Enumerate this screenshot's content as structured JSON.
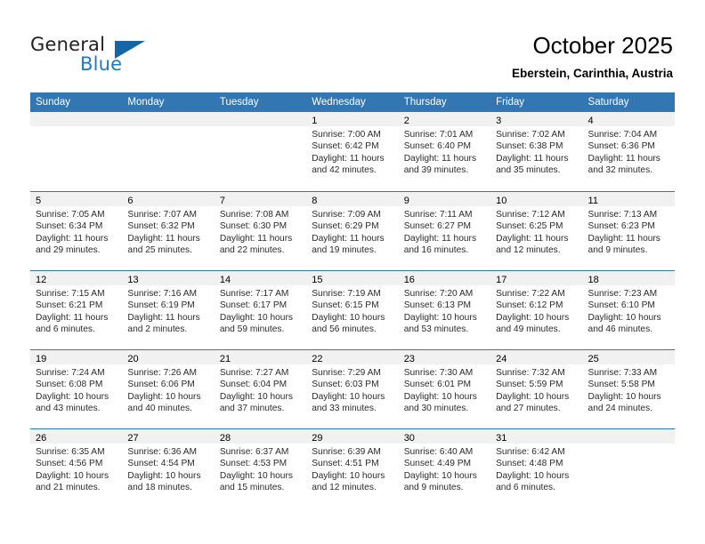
{
  "brand": {
    "name_part1": "General",
    "name_part2": "Blue",
    "logo_icon": "blue-triangle-flag-icon"
  },
  "header": {
    "month_title": "October 2025",
    "location": "Eberstein, Carinthia, Austria"
  },
  "colors": {
    "header_blue": "#3277b3",
    "brand_blue": "#1f7ac4",
    "band_gray": "#f1f1f1"
  },
  "calendar": {
    "weekdays": [
      "Sunday",
      "Monday",
      "Tuesday",
      "Wednesday",
      "Thursday",
      "Friday",
      "Saturday"
    ],
    "weeks": [
      [
        {
          "day": "",
          "sunrise": "",
          "sunset": "",
          "daylight": "",
          "daylight2": ""
        },
        {
          "day": "",
          "sunrise": "",
          "sunset": "",
          "daylight": "",
          "daylight2": ""
        },
        {
          "day": "",
          "sunrise": "",
          "sunset": "",
          "daylight": "",
          "daylight2": ""
        },
        {
          "day": "1",
          "sunrise": "Sunrise: 7:00 AM",
          "sunset": "Sunset: 6:42 PM",
          "daylight": "Daylight: 11 hours",
          "daylight2": "and 42 minutes."
        },
        {
          "day": "2",
          "sunrise": "Sunrise: 7:01 AM",
          "sunset": "Sunset: 6:40 PM",
          "daylight": "Daylight: 11 hours",
          "daylight2": "and 39 minutes."
        },
        {
          "day": "3",
          "sunrise": "Sunrise: 7:02 AM",
          "sunset": "Sunset: 6:38 PM",
          "daylight": "Daylight: 11 hours",
          "daylight2": "and 35 minutes."
        },
        {
          "day": "4",
          "sunrise": "Sunrise: 7:04 AM",
          "sunset": "Sunset: 6:36 PM",
          "daylight": "Daylight: 11 hours",
          "daylight2": "and 32 minutes."
        }
      ],
      [
        {
          "day": "5",
          "sunrise": "Sunrise: 7:05 AM",
          "sunset": "Sunset: 6:34 PM",
          "daylight": "Daylight: 11 hours",
          "daylight2": "and 29 minutes."
        },
        {
          "day": "6",
          "sunrise": "Sunrise: 7:07 AM",
          "sunset": "Sunset: 6:32 PM",
          "daylight": "Daylight: 11 hours",
          "daylight2": "and 25 minutes."
        },
        {
          "day": "7",
          "sunrise": "Sunrise: 7:08 AM",
          "sunset": "Sunset: 6:30 PM",
          "daylight": "Daylight: 11 hours",
          "daylight2": "and 22 minutes."
        },
        {
          "day": "8",
          "sunrise": "Sunrise: 7:09 AM",
          "sunset": "Sunset: 6:29 PM",
          "daylight": "Daylight: 11 hours",
          "daylight2": "and 19 minutes."
        },
        {
          "day": "9",
          "sunrise": "Sunrise: 7:11 AM",
          "sunset": "Sunset: 6:27 PM",
          "daylight": "Daylight: 11 hours",
          "daylight2": "and 16 minutes."
        },
        {
          "day": "10",
          "sunrise": "Sunrise: 7:12 AM",
          "sunset": "Sunset: 6:25 PM",
          "daylight": "Daylight: 11 hours",
          "daylight2": "and 12 minutes."
        },
        {
          "day": "11",
          "sunrise": "Sunrise: 7:13 AM",
          "sunset": "Sunset: 6:23 PM",
          "daylight": "Daylight: 11 hours",
          "daylight2": "and 9 minutes."
        }
      ],
      [
        {
          "day": "12",
          "sunrise": "Sunrise: 7:15 AM",
          "sunset": "Sunset: 6:21 PM",
          "daylight": "Daylight: 11 hours",
          "daylight2": "and 6 minutes."
        },
        {
          "day": "13",
          "sunrise": "Sunrise: 7:16 AM",
          "sunset": "Sunset: 6:19 PM",
          "daylight": "Daylight: 11 hours",
          "daylight2": "and 2 minutes."
        },
        {
          "day": "14",
          "sunrise": "Sunrise: 7:17 AM",
          "sunset": "Sunset: 6:17 PM",
          "daylight": "Daylight: 10 hours",
          "daylight2": "and 59 minutes."
        },
        {
          "day": "15",
          "sunrise": "Sunrise: 7:19 AM",
          "sunset": "Sunset: 6:15 PM",
          "daylight": "Daylight: 10 hours",
          "daylight2": "and 56 minutes."
        },
        {
          "day": "16",
          "sunrise": "Sunrise: 7:20 AM",
          "sunset": "Sunset: 6:13 PM",
          "daylight": "Daylight: 10 hours",
          "daylight2": "and 53 minutes."
        },
        {
          "day": "17",
          "sunrise": "Sunrise: 7:22 AM",
          "sunset": "Sunset: 6:12 PM",
          "daylight": "Daylight: 10 hours",
          "daylight2": "and 49 minutes."
        },
        {
          "day": "18",
          "sunrise": "Sunrise: 7:23 AM",
          "sunset": "Sunset: 6:10 PM",
          "daylight": "Daylight: 10 hours",
          "daylight2": "and 46 minutes."
        }
      ],
      [
        {
          "day": "19",
          "sunrise": "Sunrise: 7:24 AM",
          "sunset": "Sunset: 6:08 PM",
          "daylight": "Daylight: 10 hours",
          "daylight2": "and 43 minutes."
        },
        {
          "day": "20",
          "sunrise": "Sunrise: 7:26 AM",
          "sunset": "Sunset: 6:06 PM",
          "daylight": "Daylight: 10 hours",
          "daylight2": "and 40 minutes."
        },
        {
          "day": "21",
          "sunrise": "Sunrise: 7:27 AM",
          "sunset": "Sunset: 6:04 PM",
          "daylight": "Daylight: 10 hours",
          "daylight2": "and 37 minutes."
        },
        {
          "day": "22",
          "sunrise": "Sunrise: 7:29 AM",
          "sunset": "Sunset: 6:03 PM",
          "daylight": "Daylight: 10 hours",
          "daylight2": "and 33 minutes."
        },
        {
          "day": "23",
          "sunrise": "Sunrise: 7:30 AM",
          "sunset": "Sunset: 6:01 PM",
          "daylight": "Daylight: 10 hours",
          "daylight2": "and 30 minutes."
        },
        {
          "day": "24",
          "sunrise": "Sunrise: 7:32 AM",
          "sunset": "Sunset: 5:59 PM",
          "daylight": "Daylight: 10 hours",
          "daylight2": "and 27 minutes."
        },
        {
          "day": "25",
          "sunrise": "Sunrise: 7:33 AM",
          "sunset": "Sunset: 5:58 PM",
          "daylight": "Daylight: 10 hours",
          "daylight2": "and 24 minutes."
        }
      ],
      [
        {
          "day": "26",
          "sunrise": "Sunrise: 6:35 AM",
          "sunset": "Sunset: 4:56 PM",
          "daylight": "Daylight: 10 hours",
          "daylight2": "and 21 minutes."
        },
        {
          "day": "27",
          "sunrise": "Sunrise: 6:36 AM",
          "sunset": "Sunset: 4:54 PM",
          "daylight": "Daylight: 10 hours",
          "daylight2": "and 18 minutes."
        },
        {
          "day": "28",
          "sunrise": "Sunrise: 6:37 AM",
          "sunset": "Sunset: 4:53 PM",
          "daylight": "Daylight: 10 hours",
          "daylight2": "and 15 minutes."
        },
        {
          "day": "29",
          "sunrise": "Sunrise: 6:39 AM",
          "sunset": "Sunset: 4:51 PM",
          "daylight": "Daylight: 10 hours",
          "daylight2": "and 12 minutes."
        },
        {
          "day": "30",
          "sunrise": "Sunrise: 6:40 AM",
          "sunset": "Sunset: 4:49 PM",
          "daylight": "Daylight: 10 hours",
          "daylight2": "and 9 minutes."
        },
        {
          "day": "31",
          "sunrise": "Sunrise: 6:42 AM",
          "sunset": "Sunset: 4:48 PM",
          "daylight": "Daylight: 10 hours",
          "daylight2": "and 6 minutes."
        },
        {
          "day": "",
          "sunrise": "",
          "sunset": "",
          "daylight": "",
          "daylight2": ""
        }
      ]
    ]
  }
}
